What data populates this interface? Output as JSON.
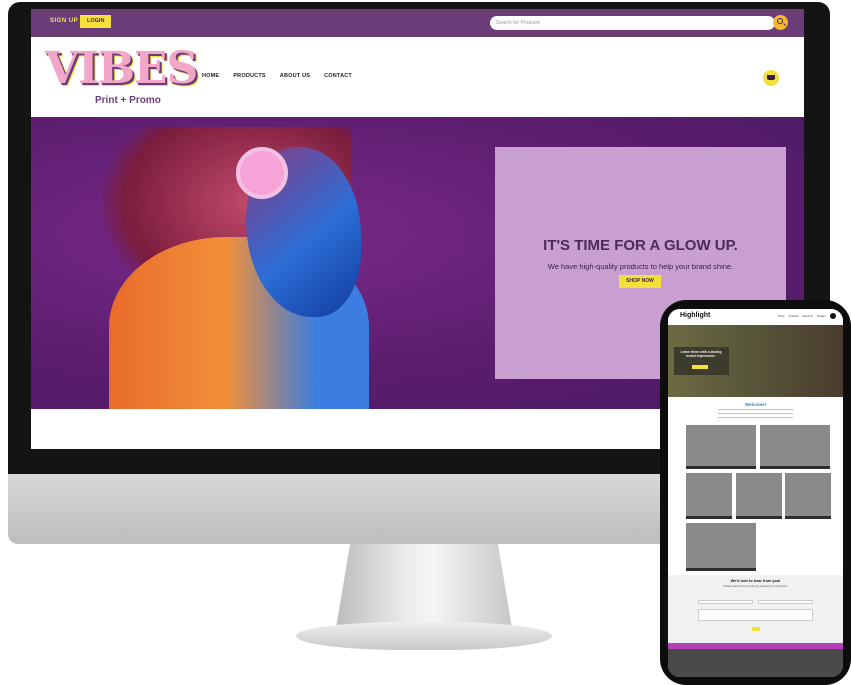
{
  "desktop": {
    "topbar": {
      "signup_label": "SIGN UP",
      "login_label": "LOGIN",
      "search_placeholder": "Search for Products",
      "color": "#6b3d78"
    },
    "header": {
      "logo_text": "VIBES",
      "logo_sub": "Print + Promo",
      "nav": [
        "HOME",
        "PRODUCTS",
        "ABOUT US",
        "CONTACT"
      ]
    },
    "hero": {
      "title": "IT'S TIME FOR A GLOW UP.",
      "subtitle": "We have high-quality products to help your brand shine.",
      "cta": "SHOP NOW"
    }
  },
  "phone": {
    "logo_text": "Highlight",
    "nav": [
      "Home",
      "Products",
      "About Us",
      "Contact"
    ],
    "hero_title": "Leave them with a lasting brand impression.",
    "welcome": "Welcome!",
    "form_title": "We'd love to hear from you!",
    "form_sub": "Please reach out to us with any questions or comments.",
    "form_fields": [
      "Name",
      "Email",
      "Message"
    ]
  },
  "colors": {
    "accent_yellow": "#f3e03a",
    "brand_purple": "#6b3d78",
    "promo_box": "#c99ed0",
    "footer_magenta": "#b43fb8"
  }
}
